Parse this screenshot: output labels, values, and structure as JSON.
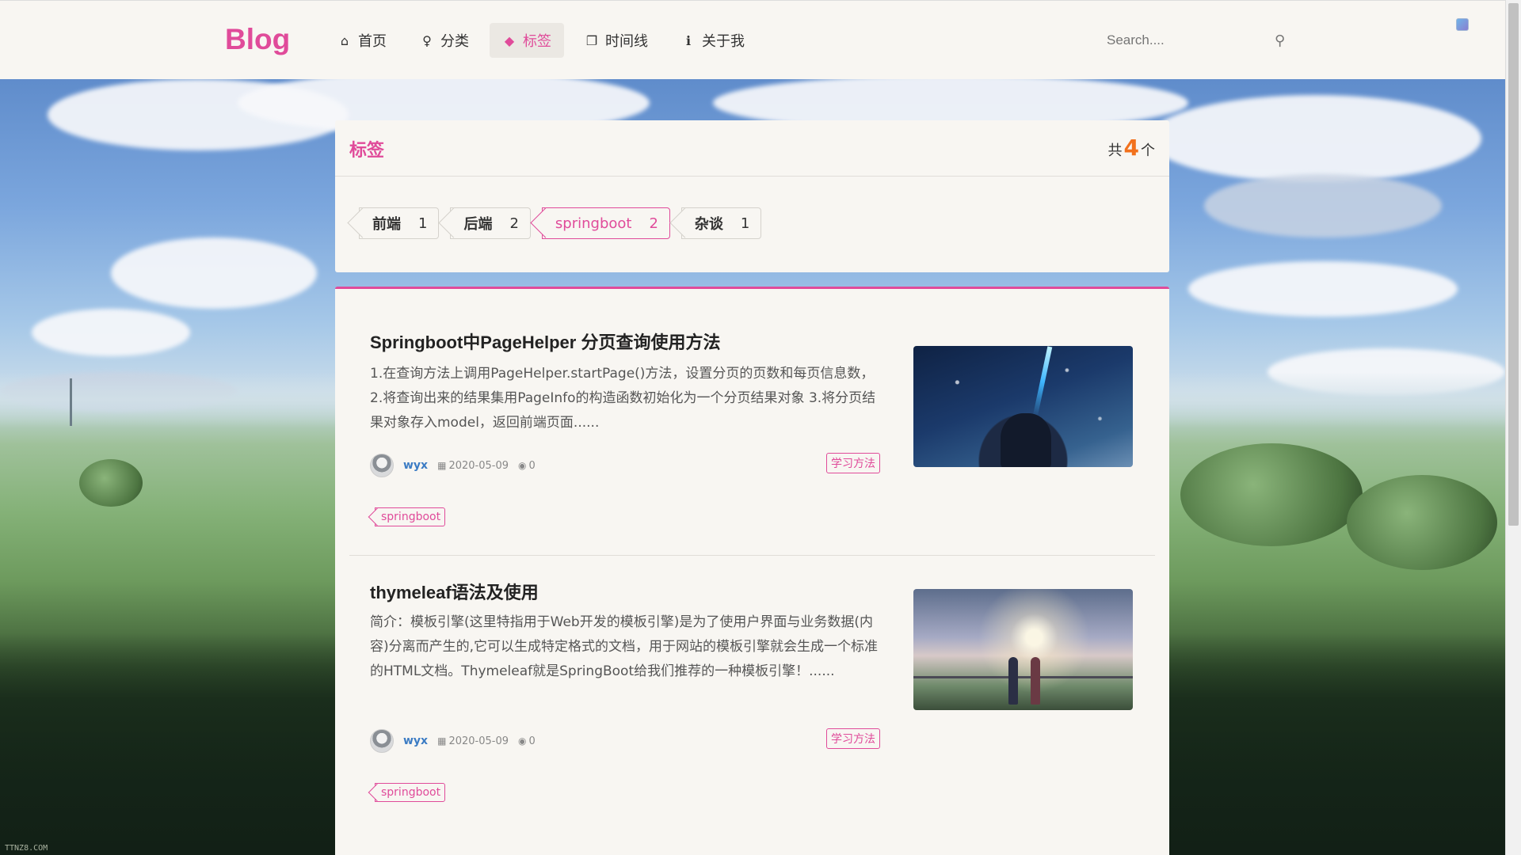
{
  "header": {
    "logo": "Blog",
    "nav": [
      {
        "label": "首页",
        "icon": "home-icon",
        "glyph": "⌂"
      },
      {
        "label": "分类",
        "icon": "lightbulb-icon",
        "glyph": "♀"
      },
      {
        "label": "标签",
        "icon": "tags-icon",
        "glyph": "◆"
      },
      {
        "label": "时间线",
        "icon": "clone-icon",
        "glyph": "❐"
      },
      {
        "label": "关于我",
        "icon": "info-icon",
        "glyph": "ℹ"
      }
    ],
    "active_nav": "标签",
    "search": {
      "placeholder": "Search...."
    }
  },
  "tag_panel": {
    "title": "标签",
    "count_prefix": "共",
    "count": "4",
    "count_suffix": "个",
    "tags": [
      {
        "name": "前端",
        "count": "1"
      },
      {
        "name": "后端",
        "count": "2"
      },
      {
        "name": "springboot",
        "count": "2",
        "active": true
      },
      {
        "name": "杂谈",
        "count": "1"
      }
    ]
  },
  "articles": [
    {
      "title": "Springboot中PageHelper 分页查询使用方法",
      "summary": "1.在查询方法上调用PageHelper.startPage()方法，设置分页的页数和每页信息数， 2.将查询出来的结果集用PageInfo的构造函数初始化为一个分页结果对象 3.将分页结果对象存入model，返回前端页面......",
      "author": "wyx",
      "date": "2020-05-09",
      "views": "0",
      "category": "学习方法",
      "tag": "springboot"
    },
    {
      "title": "thymeleaf语法及使用",
      "summary": "简介：模板引擎(这里特指用于Web开发的模板引擎)是为了使用户界面与业务数据(内容)分离而产生的,它可以生成特定格式的文档，用于网站的模板引擎就会生成一个标准的HTML文档。Thymeleaf就是SpringBoot给我们推荐的一种模板引擎！......",
      "author": "wyx",
      "date": "2020-05-09",
      "views": "0",
      "category": "学习方法",
      "tag": "springboot"
    }
  ],
  "icons": {
    "search": "⚲",
    "calendar": "▦",
    "eye": "◉"
  },
  "watermark": "TTNZ8.COM",
  "colors": {
    "accent": "#e04b9a",
    "count": "#f2711c",
    "author": "#3c7cc4"
  }
}
